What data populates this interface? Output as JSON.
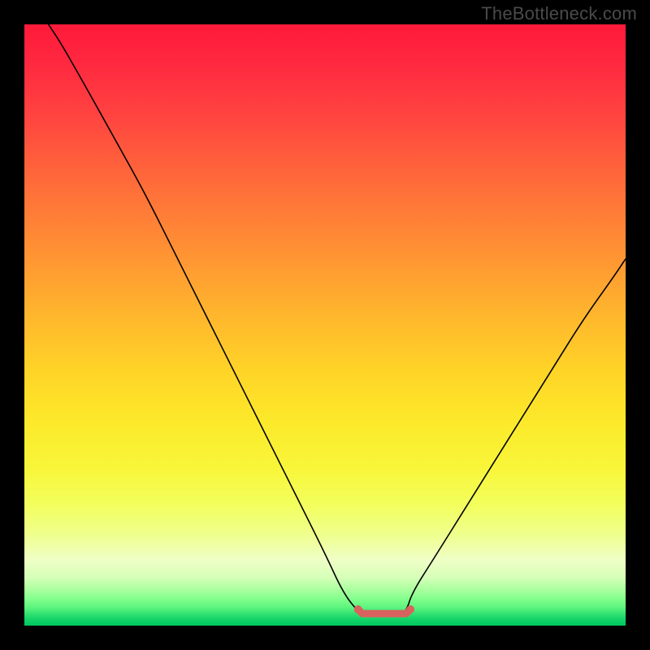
{
  "brand": {
    "credit": "TheBottleneck.com"
  },
  "chart_data": {
    "type": "line",
    "title": "",
    "xlabel": "",
    "ylabel": "",
    "x_range": [
      0,
      1
    ],
    "y_range": [
      0,
      1
    ],
    "gradient_stops": [
      {
        "stop": 0.0,
        "color": "#ff1a3a"
      },
      {
        "stop": 0.5,
        "color": "#ffd527"
      },
      {
        "stop": 0.8,
        "color": "#f3ff5e"
      },
      {
        "stop": 1.0,
        "color": "#00c860"
      }
    ],
    "series": [
      {
        "name": "bottleneck-curve",
        "color": "#000000",
        "points": [
          {
            "x": 0.04,
            "y": 1.0
          },
          {
            "x": 0.06,
            "y": 0.97
          },
          {
            "x": 0.1,
            "y": 0.9
          },
          {
            "x": 0.15,
            "y": 0.81
          },
          {
            "x": 0.2,
            "y": 0.72
          },
          {
            "x": 0.25,
            "y": 0.62
          },
          {
            "x": 0.3,
            "y": 0.52
          },
          {
            "x": 0.35,
            "y": 0.42
          },
          {
            "x": 0.4,
            "y": 0.32
          },
          {
            "x": 0.45,
            "y": 0.22
          },
          {
            "x": 0.5,
            "y": 0.12
          },
          {
            "x": 0.53,
            "y": 0.055
          },
          {
            "x": 0.555,
            "y": 0.023
          },
          {
            "x": 0.565,
            "y": 0.02
          },
          {
            "x": 0.62,
            "y": 0.02
          },
          {
            "x": 0.635,
            "y": 0.023
          },
          {
            "x": 0.645,
            "y": 0.055
          },
          {
            "x": 0.68,
            "y": 0.11
          },
          {
            "x": 0.73,
            "y": 0.19
          },
          {
            "x": 0.78,
            "y": 0.27
          },
          {
            "x": 0.83,
            "y": 0.35
          },
          {
            "x": 0.88,
            "y": 0.43
          },
          {
            "x": 0.93,
            "y": 0.51
          },
          {
            "x": 0.98,
            "y": 0.58
          },
          {
            "x": 1.0,
            "y": 0.61
          }
        ]
      },
      {
        "name": "optimal-band",
        "color": "#d8625e",
        "points": [
          {
            "x": 0.555,
            "y": 0.027
          },
          {
            "x": 0.562,
            "y": 0.02
          },
          {
            "x": 0.6,
            "y": 0.02
          },
          {
            "x": 0.635,
            "y": 0.02
          },
          {
            "x": 0.642,
            "y": 0.027
          }
        ],
        "endpoint_dots": [
          {
            "x": 0.555,
            "y": 0.027,
            "r": 5
          },
          {
            "x": 0.642,
            "y": 0.027,
            "r": 5
          }
        ]
      }
    ]
  }
}
